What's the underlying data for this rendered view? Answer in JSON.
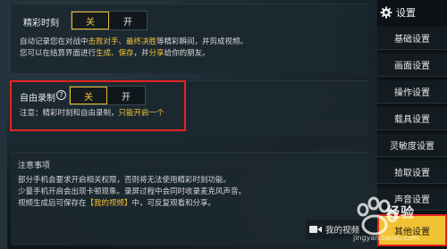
{
  "settings": {
    "title": "设置",
    "icon": "gear-icon"
  },
  "sidebar": {
    "items": [
      {
        "label": "基础设置"
      },
      {
        "label": "画面设置"
      },
      {
        "label": "操作设置"
      },
      {
        "label": "载具设置"
      },
      {
        "label": "灵敏度设置"
      },
      {
        "label": "拾取设置"
      },
      {
        "label": "声音设置"
      },
      {
        "label": "其他设置",
        "active": true
      }
    ]
  },
  "highlight": {
    "label": "精彩时刻",
    "off_label": "关",
    "on_label": "开",
    "selected": "关",
    "desc1_a": "自动记录您在对战中",
    "desc1_b": "击败对手、最终决胜",
    "desc1_c": "等精彩瞬间，并剪成视频。",
    "desc2_a": "您可以在结算界面进行",
    "desc2_b": "生成、保存",
    "desc2_c": "，并",
    "desc2_d": "分享",
    "desc2_e": "给你的朋友。"
  },
  "free_record": {
    "label": "自由录制",
    "help_icon": "question-circle-icon",
    "off_label": "关",
    "on_label": "开",
    "selected": "关",
    "note_a": "注意：精彩时刻和自由录制，",
    "note_b": "只能开启一个"
  },
  "notes": {
    "title": "注意事项",
    "line1": "部分手机会要求开启相关权限，否则将无法使用精彩时刻功能。",
    "line2": "少量手机开启会出现卡顿现象。录屏过程中会同时收录麦克风声音。",
    "line3_a": "视频生成后可保存在",
    "line3_b": "【我的视频】",
    "line3_c": "中，可反复观看和分享。"
  },
  "my_video": {
    "label": "我的视频",
    "icon": "video-camera-icon"
  },
  "watermark": {
    "text": "经验",
    "url": "jingyan.baidu.com"
  },
  "colors": {
    "accent": "#f1c233",
    "highlight_red": "#e6231e",
    "text_yellow": "#f0c33c"
  }
}
